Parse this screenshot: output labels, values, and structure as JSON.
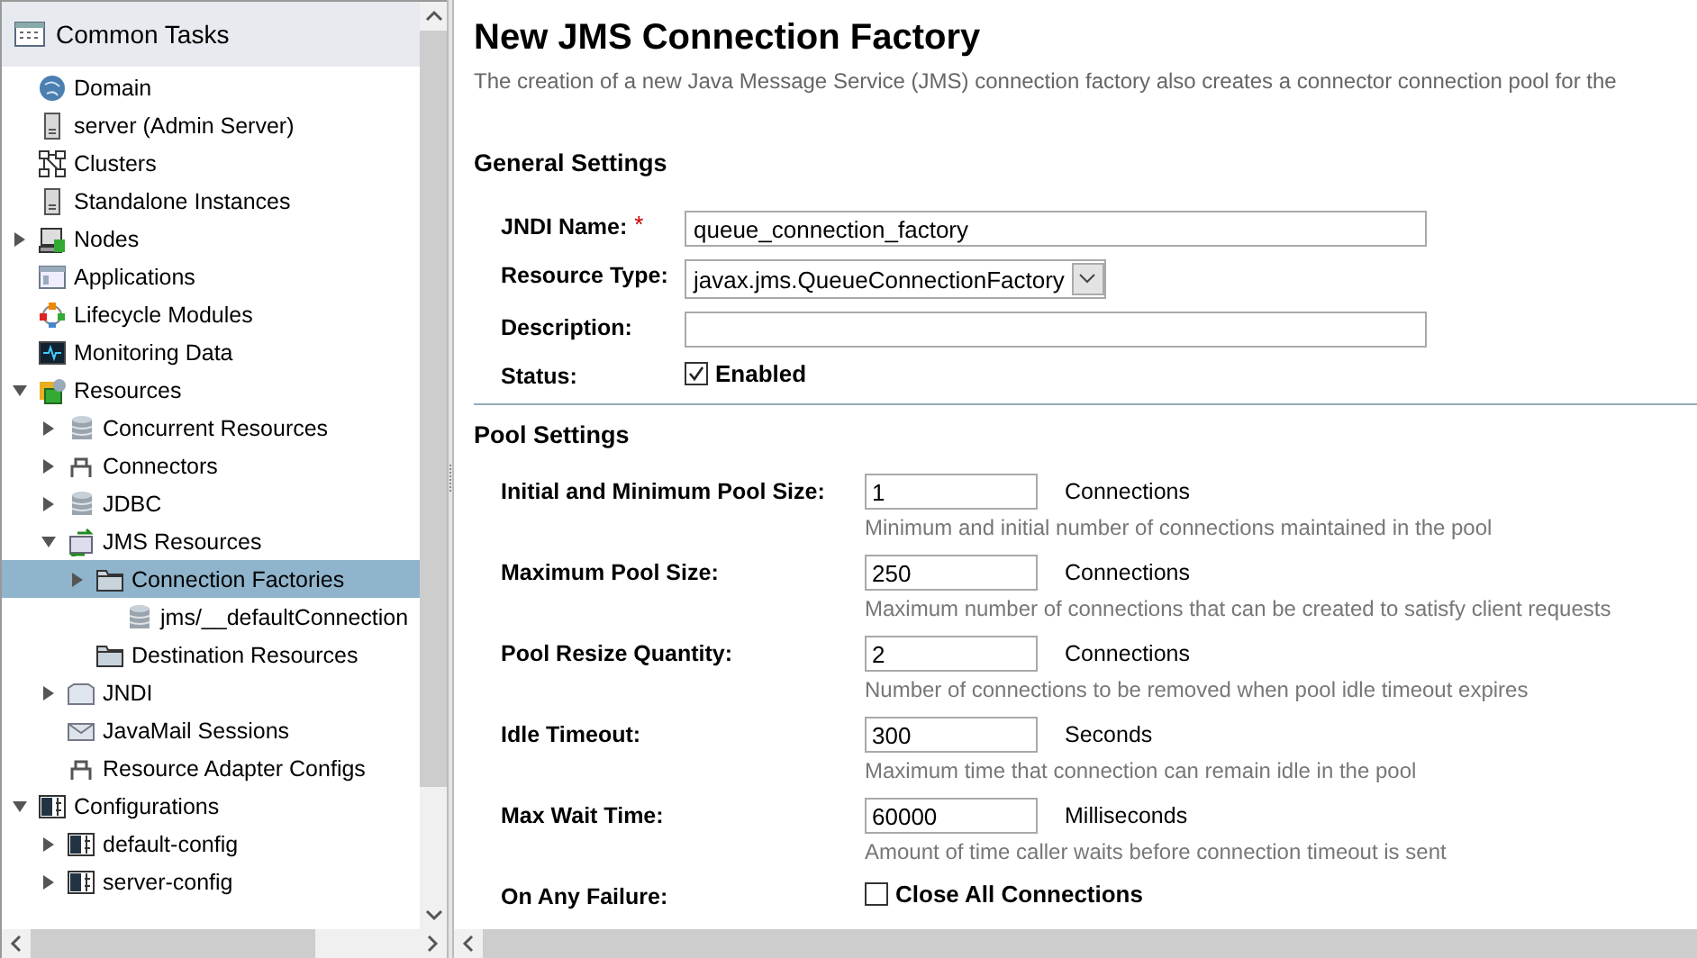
{
  "sidebar": {
    "title": "Common Tasks",
    "items": [
      {
        "label": "Domain",
        "kind": "globe"
      },
      {
        "label": "server (Admin Server)",
        "kind": "server"
      },
      {
        "label": "Clusters",
        "kind": "cluster"
      },
      {
        "label": "Standalone Instances",
        "kind": "server"
      },
      {
        "label": "Nodes",
        "kind": "node",
        "expanded": false
      },
      {
        "label": "Applications",
        "kind": "app"
      },
      {
        "label": "Lifecycle Modules",
        "kind": "lifecycle"
      },
      {
        "label": "Monitoring Data",
        "kind": "monitor"
      },
      {
        "label": "Resources",
        "kind": "resources",
        "expanded": true,
        "children": [
          {
            "label": "Concurrent Resources",
            "kind": "database",
            "expanded": false
          },
          {
            "label": "Connectors",
            "kind": "connector",
            "expanded": false
          },
          {
            "label": "JDBC",
            "kind": "database",
            "expanded": false
          },
          {
            "label": "JMS Resources",
            "kind": "jms",
            "expanded": true,
            "children": [
              {
                "label": "Connection Factories",
                "kind": "folder",
                "expanded": false,
                "selected": true,
                "children": [
                  {
                    "label": "jms/__defaultConnection",
                    "kind": "database"
                  }
                ]
              },
              {
                "label": "Destination Resources",
                "kind": "folder"
              }
            ]
          },
          {
            "label": "JNDI",
            "kind": "jndi",
            "expanded": false
          },
          {
            "label": "JavaMail Sessions",
            "kind": "mail"
          },
          {
            "label": "Resource Adapter Configs",
            "kind": "connector"
          }
        ]
      },
      {
        "label": "Configurations",
        "kind": "config",
        "expanded": true,
        "children": [
          {
            "label": "default-config",
            "kind": "config",
            "expanded": false
          },
          {
            "label": "server-config",
            "kind": "config",
            "expanded": false
          }
        ]
      }
    ]
  },
  "main": {
    "title": "New JMS Connection Factory",
    "description": "The creation of a new Java Message Service (JMS) connection factory also creates a connector connection pool for the",
    "general": {
      "heading": "General Settings",
      "fields": [
        {
          "kind": "text",
          "label": "JNDI Name:",
          "required_marker": "*",
          "value": "queue_connection_factory"
        },
        {
          "kind": "select",
          "label": "Resource Type:",
          "value": "javax.jms.QueueConnectionFactory"
        },
        {
          "kind": "text",
          "label": "Description:"
        },
        {
          "kind": "checkbox",
          "label": "Status:",
          "option": "Enabled",
          "checked": true
        }
      ]
    },
    "pool": {
      "heading": "Pool Settings",
      "fields": [
        {
          "kind": "number",
          "label": "Initial and Minimum Pool Size:",
          "value": "1",
          "unit": "Connections",
          "help": "Minimum and initial number of connections maintained in the pool"
        },
        {
          "kind": "number",
          "label": "Maximum Pool Size:",
          "value": "250",
          "unit": "Connections",
          "help": "Maximum number of connections that can be created to satisfy client requests"
        },
        {
          "kind": "number",
          "label": "Pool Resize Quantity:",
          "value": "2",
          "unit": "Connections",
          "help": "Number of connections to be removed when pool idle timeout expires"
        },
        {
          "kind": "number",
          "label": "Idle Timeout:",
          "value": "300",
          "unit": "Seconds",
          "help": "Maximum time that connection can remain idle in the pool"
        },
        {
          "kind": "number",
          "label": "Max Wait Time:",
          "value": "60000",
          "unit": "Milliseconds",
          "help": "Amount of time caller waits before connection timeout is sent"
        },
        {
          "kind": "checkbox",
          "label": "On Any Failure:",
          "option": "Close All Connections",
          "checked": false
        }
      ]
    }
  }
}
